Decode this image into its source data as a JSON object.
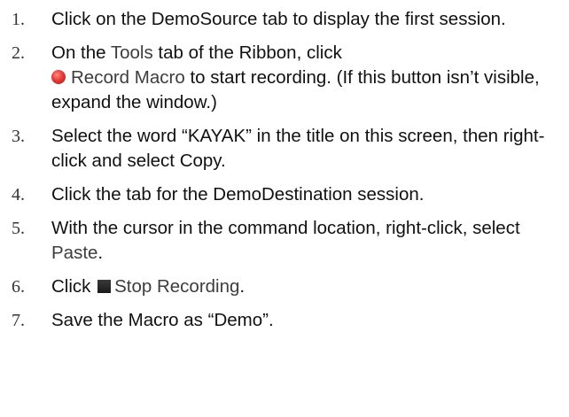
{
  "steps": [
    {
      "num": "1.",
      "text": "Click on the DemoSource tab to display the first session."
    },
    {
      "num": "2.",
      "pre": "On the ",
      "ref1": "Tools",
      "mid1": " tab of the Ribbon, click ",
      "icon": "record-icon",
      "ref2": "Record Macro",
      "post": " to start recording. (If this button isn’t visible, expand the window.)"
    },
    {
      "num": "3.",
      "text": "Select the word “KAYAK” in the title on this screen, then right-click and select Copy."
    },
    {
      "num": "4.",
      "text": "Click the tab for the DemoDestination session."
    },
    {
      "num": "5.",
      "pre": "With the cursor in the command location, right-click, select ",
      "ref1": "Paste",
      "post": "."
    },
    {
      "num": "6.",
      "pre": "Click ",
      "icon": "stop-icon",
      "ref1": "Stop Recording",
      "post": "."
    },
    {
      "num": "7.",
      "text": "Save the Macro as “Demo”."
    }
  ],
  "colors": {
    "record_icon": "#e53935",
    "stop_icon": "#222222"
  }
}
